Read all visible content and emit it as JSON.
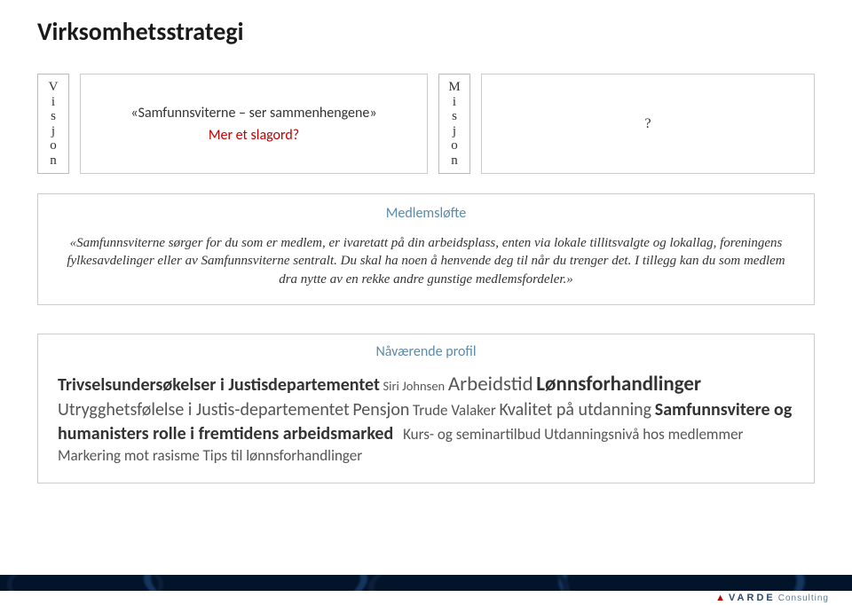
{
  "title": "Virksomhetsstrategi",
  "vision": {
    "label_letters": [
      "V",
      "i",
      "s",
      "j",
      "o",
      "n"
    ],
    "line1": "«Samfunnsviterne – ser sammenhengene»",
    "line2": "Mer et slagord?"
  },
  "mission": {
    "label_letters": [
      "M",
      "i",
      "s",
      "j",
      "o",
      "n"
    ],
    "content": "?"
  },
  "medlemslofte": {
    "header": "Medlemsløfte",
    "body": "«Samfunnsviterne sørger for du som er medlem, er ivaretatt på din arbeidsplass, enten via lokale tillitsvalgte og lokallag, foreningens fylkesavdelinger eller av Samfunnsviterne sentralt. Du skal ha noen å henvende deg til når du trenger det. I tillegg kan du som medlem dra nytte av en rekke andre gunstige medlemsfordeler.»"
  },
  "profil": {
    "header": "Nåværende profil",
    "words": {
      "w1": "Trivselsundersøkelser i Justisdepartementet",
      "w2": "Siri Johnsen",
      "w3": "Arbeidstid",
      "w4": "Lønnsforhandlinger",
      "w5": "Utrygghetsfølelse i Justis-departementet",
      "w6": "Pensjon",
      "w7": "Trude Valaker",
      "w8": "Kvalitet på utdanning",
      "w9": "Samfunnsvitere og humanisters rolle i fremtidens arbeidsmarked",
      "w10": "Kurs- og seminartilbud",
      "w11": "Utdanningsnivå hos medlemmer",
      "w12": "Markering mot rasisme",
      "w13": "Tips til lønnsforhandlinger"
    }
  },
  "brand": {
    "name": "VARDE",
    "sub": "Consulting"
  }
}
